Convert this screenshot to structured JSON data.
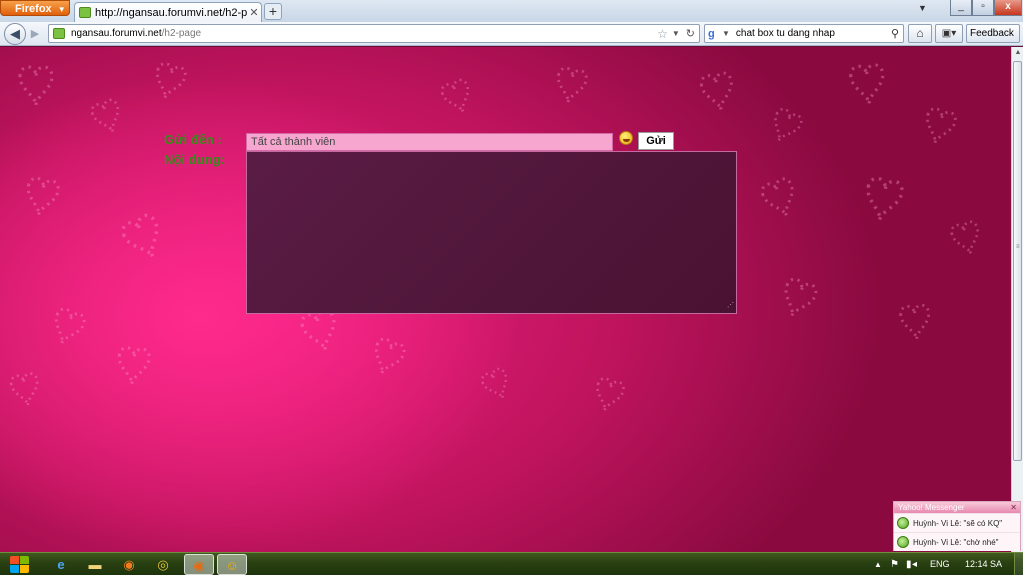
{
  "browser": {
    "menu_button": "Firefox",
    "tab_title": "http://ngansau.forumvi.net/h2-page",
    "new_tab_glyph": "+",
    "url_domain": "ngansau.forumvi.net",
    "url_path": "/h2-page",
    "search_text": "chat box tu dang nhap",
    "feedback_label": "Feedback"
  },
  "form": {
    "to_label": "Gửi đến :",
    "content_label": "Nội dung:",
    "recipient_value": "Tất cả thành viên",
    "send_label": "Gửi",
    "content_value": ""
  },
  "messenger": {
    "title": "Yahoo! Messenger",
    "notifications": [
      {
        "text": "Huỳnh- Vi Lê: \"sẽ có KQ\""
      },
      {
        "text": "Huỳnh- Vi Lê: \"chờ nhé\""
      }
    ]
  },
  "taskbar": {
    "language": "ENG",
    "clock": "12:14 SA"
  },
  "colors": {
    "page_accent": "#e81d7c",
    "label_green": "#3a8a1d",
    "input_pink": "#f7a6d0",
    "textarea_plum": "#4a1232"
  },
  "icons": [
    "firefox-menu-icon",
    "favicon-icon",
    "back-arrow-icon",
    "forward-arrow-icon",
    "bookmark-star-icon",
    "reload-icon",
    "google-icon",
    "search-icon",
    "home-icon",
    "emoticon-icon",
    "windows-start-icon",
    "ie-icon",
    "folder-icon",
    "firefox-icon",
    "chrome-icon",
    "yahoo-messenger-icon"
  ]
}
